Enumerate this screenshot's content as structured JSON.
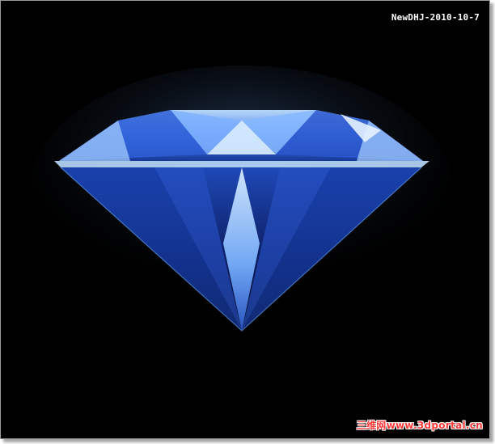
{
  "image": {
    "stamp_text": "NewDHJ-2010-10-7",
    "watermark_text": "三维网www.3dportal.cn",
    "background_color": "#000000",
    "gem_colors": {
      "deep": "#0b1a5a",
      "mid": "#2c55c8",
      "light": "#9ec8ff",
      "highlight": "#e6f3ff"
    }
  }
}
